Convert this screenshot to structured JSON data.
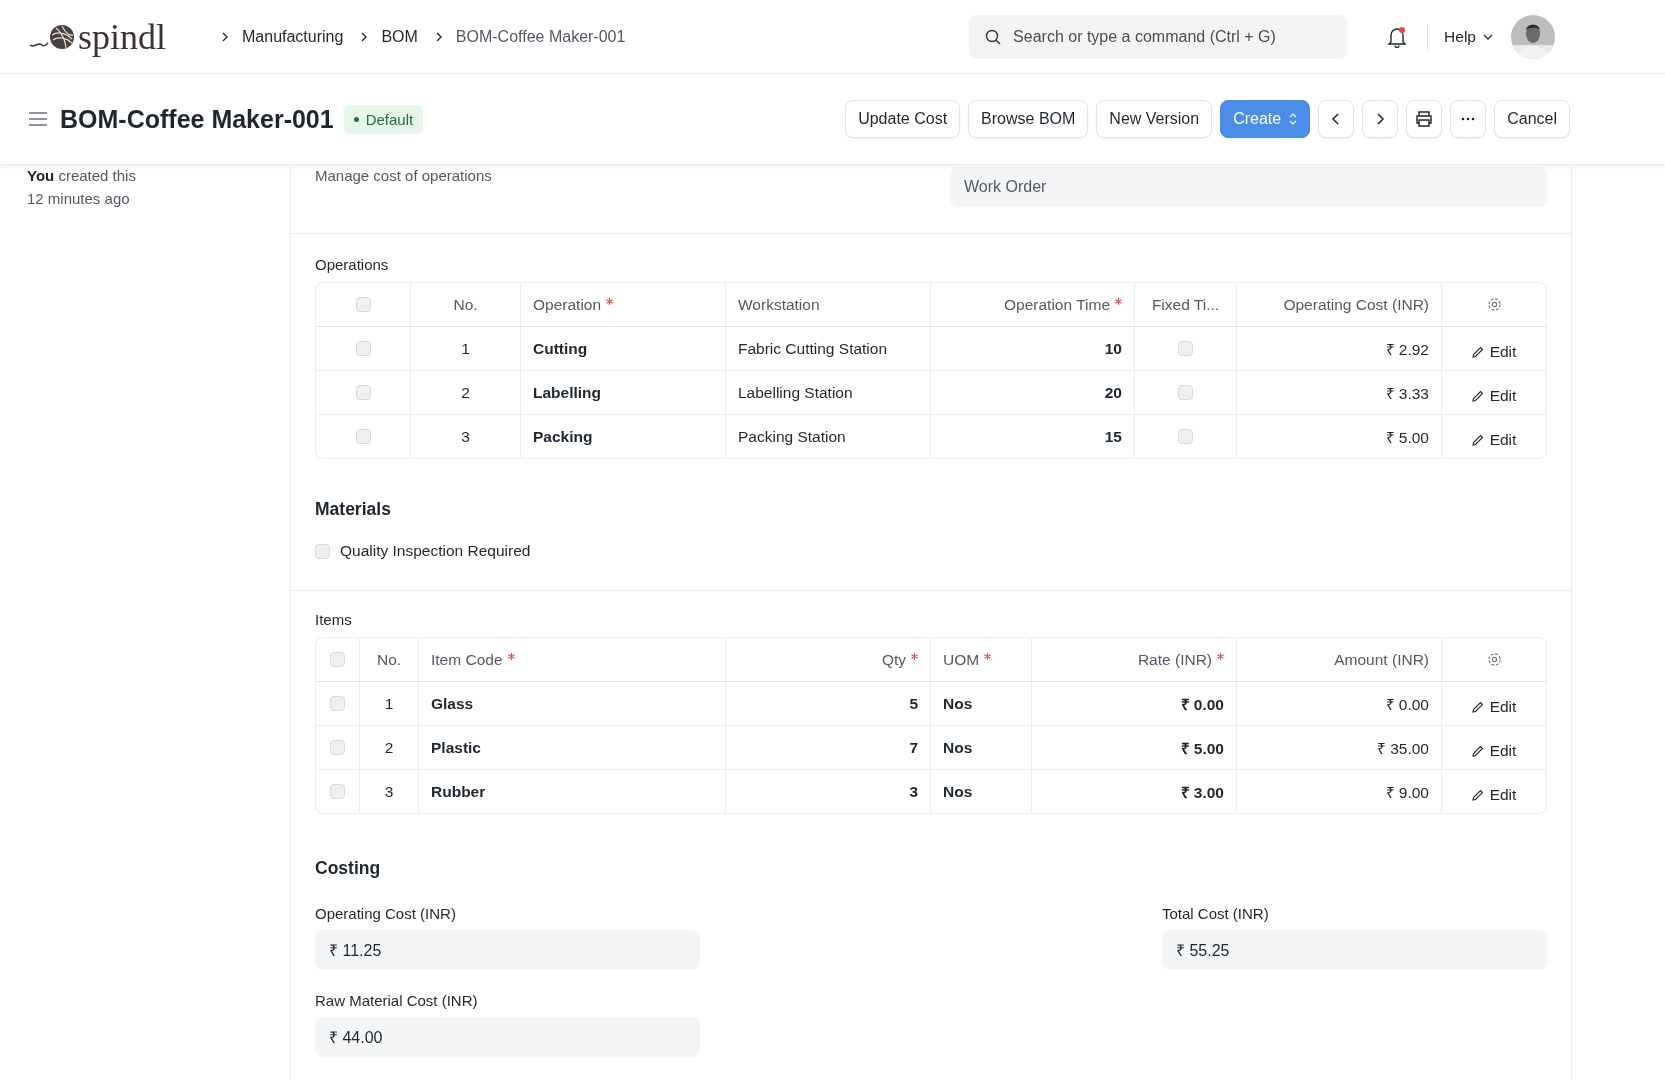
{
  "logo": "spindl",
  "breadcrumbs": [
    "Manufacturing",
    "BOM",
    "BOM-Coffee Maker-001"
  ],
  "search": {
    "placeholder": "Search or type a command (Ctrl + G)"
  },
  "notifications": {
    "unread": true
  },
  "help": "Help",
  "page": {
    "title": "BOM-Coffee Maker-001",
    "status": "Default"
  },
  "actions": [
    {
      "kind": "default",
      "label": "Update Cost"
    },
    {
      "kind": "default",
      "label": "Browse BOM"
    },
    {
      "kind": "default",
      "label": "New Version"
    },
    {
      "kind": "primary",
      "label": "Create"
    },
    {
      "kind": "prev"
    },
    {
      "kind": "next"
    },
    {
      "kind": "print"
    },
    {
      "kind": "more"
    },
    {
      "kind": "default",
      "label": "Cancel"
    }
  ],
  "sidebar": {
    "activity": "**You** created this",
    "time": "12 minutes ago"
  },
  "top_section": {
    "description": "Manage cost of operations",
    "field_value": "Work Order"
  },
  "operations": {
    "label": "Operations",
    "all_selected": false,
    "columns": [
      {
        "label": "No.",
        "required": false
      },
      {
        "label": "Operation",
        "required": true
      },
      {
        "label": "Workstation",
        "required": false
      },
      {
        "label": "Operation Time",
        "required": true
      },
      {
        "label": "Fixed Ti...",
        "required": false
      },
      {
        "label": "Operating Cost (INR)",
        "required": false
      }
    ],
    "rows": [
      {
        "selected": false,
        "no": "1",
        "operation": "Cutting",
        "workstation": "Fabric Cutting Station",
        "time": "10",
        "fixed_time": false,
        "cost": "₹ 2.92",
        "action": "Edit"
      },
      {
        "selected": false,
        "no": "2",
        "operation": "Labelling",
        "workstation": "Labelling Station",
        "time": "20",
        "fixed_time": false,
        "cost": "₹ 3.33",
        "action": "Edit"
      },
      {
        "selected": false,
        "no": "3",
        "operation": "Packing",
        "workstation": "Packing Station",
        "time": "15",
        "fixed_time": false,
        "cost": "₹ 5.00",
        "action": "Edit"
      }
    ]
  },
  "materials": {
    "title": "Materials",
    "quality_inspection": {
      "label": "Quality Inspection Required",
      "checked": false
    }
  },
  "items": {
    "label": "Items",
    "all_selected": false,
    "columns": [
      {
        "label": "No.",
        "required": false
      },
      {
        "label": "Item Code",
        "required": true
      },
      {
        "label": "Qty",
        "required": true
      },
      {
        "label": "UOM",
        "required": true
      },
      {
        "label": "Rate (INR)",
        "required": true
      },
      {
        "label": "Amount (INR)",
        "required": false
      }
    ],
    "rows": [
      {
        "selected": false,
        "no": "1",
        "item_code": "Glass",
        "qty": "5",
        "uom": "Nos",
        "rate": "₹ 0.00",
        "amount": "₹ 0.00",
        "action": "Edit"
      },
      {
        "selected": false,
        "no": "2",
        "item_code": "Plastic",
        "qty": "7",
        "uom": "Nos",
        "rate": "₹ 5.00",
        "amount": "₹ 35.00",
        "action": "Edit"
      },
      {
        "selected": false,
        "no": "3",
        "item_code": "Rubber",
        "qty": "3",
        "uom": "Nos",
        "rate": "₹ 3.00",
        "amount": "₹ 9.00",
        "action": "Edit"
      }
    ]
  },
  "costing": {
    "title": "Costing",
    "fields": [
      {
        "label": "Operating Cost (INR)",
        "value": "₹ 11.25"
      },
      {
        "label": "Total Cost (INR)",
        "value": "₹ 55.25"
      },
      {
        "label": "Raw Material Cost (INR)",
        "value": "₹ 44.00"
      }
    ]
  }
}
